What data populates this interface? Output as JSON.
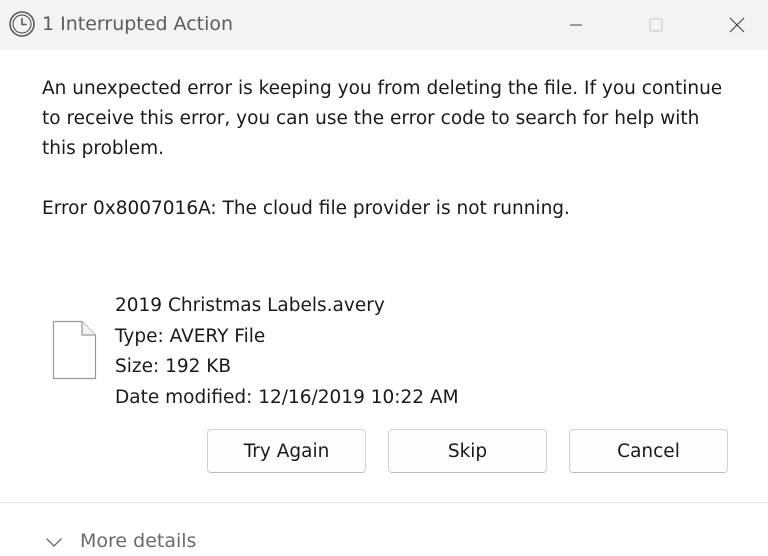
{
  "window": {
    "title": "1 Interrupted Action"
  },
  "message": {
    "lines": [
      "An unexpected error is keeping you from deleting the file. If you continue",
      "to receive this error, you can use the error code to search for help with",
      "this problem."
    ],
    "error": "Error 0x8007016A: The cloud file provider is not running."
  },
  "file": {
    "name": "2019 Christmas Labels.avery",
    "type": "Type: AVERY File",
    "size": "Size: 192 KB",
    "date_modified": "Date modified: 12/16/2019 10:22 AM",
    "icon": "generic-file-icon"
  },
  "buttons": {
    "try_again": "Try Again",
    "skip": "Skip",
    "cancel": "Cancel"
  },
  "footer": {
    "more_details": "More details"
  },
  "colors": {
    "titlebar_bg": "#f3f3f3",
    "title_text": "#5c5c5c",
    "button_border": "#d0d0d0"
  }
}
